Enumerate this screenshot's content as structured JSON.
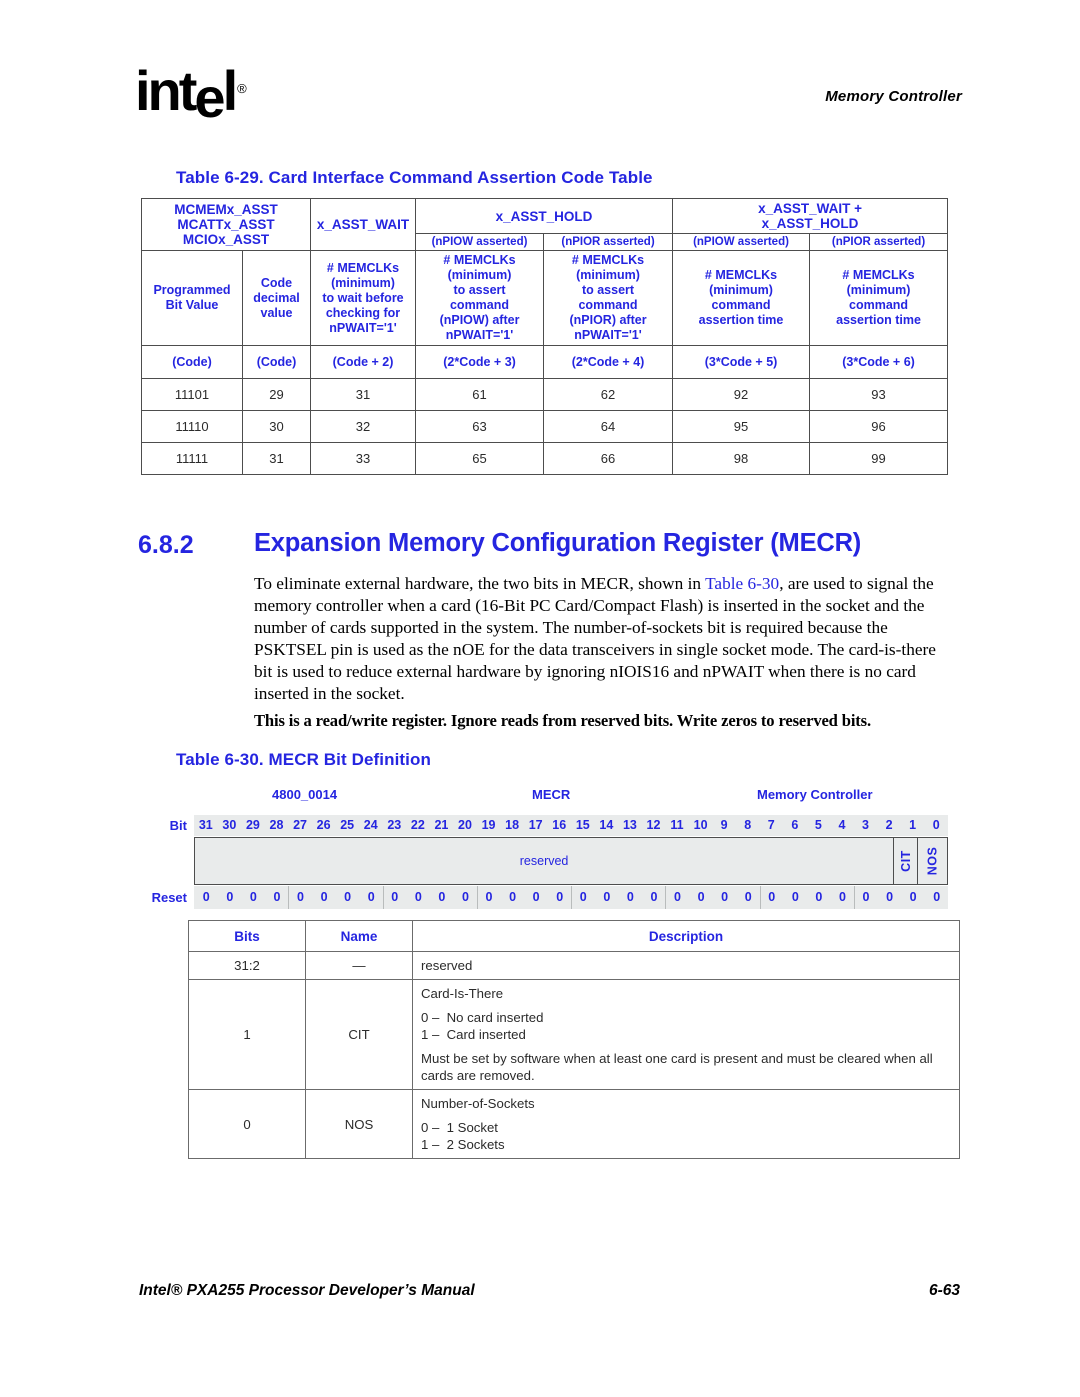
{
  "header": {
    "logo_text": "intel",
    "logo_registered": "®",
    "title": "Memory Controller"
  },
  "table_29": {
    "title": "Table 6-29. Card Interface Command Assertion Code Table",
    "group_headers": {
      "col1": "MCMEMx_ASST\nMCATTx_ASST\nMCIOx_ASST",
      "col1_line1": "MCMEMx_ASST",
      "col1_line2": "MCATTx_ASST",
      "col1_line3": "MCIOx_ASST",
      "asst_wait": "x_ASST_WAIT",
      "asst_hold": "x_ASST_HOLD",
      "wait_plus_hold_line1": "x_ASST_WAIT +",
      "wait_plus_hold_line2": "x_ASST_HOLD"
    },
    "sub_headers": [
      "(nPIOW asserted)",
      "(nPIOR asserted)",
      "(nPIOW asserted)",
      "(nPIOR asserted)"
    ],
    "column_descriptions": {
      "programmed_bit_value_line1": "Programmed",
      "programmed_bit_value_line2": "Bit Value",
      "code_decimal_line1": "Code",
      "code_decimal_line2": "decimal",
      "code_decimal_line3": "value",
      "memclks_wait": "# MEMCLKs\n(minimum)\nto wait before\nchecking for\nnPWAIT='1'",
      "memclks_wait_lines": [
        "# MEMCLKs",
        "(minimum)",
        "to wait before",
        "checking for",
        "nPWAIT='1'"
      ],
      "memclks_piow_assert_lines": [
        "# MEMCLKs",
        "(minimum)",
        "to assert",
        "command",
        "(nPIOW) after",
        "nPWAIT='1'"
      ],
      "memclks_pior_assert_lines": [
        "# MEMCLKs",
        "(minimum)",
        "to assert",
        "command",
        "(nPIOR) after",
        "nPWAIT='1'"
      ],
      "memclks_piow_time_lines": [
        "# MEMCLKs",
        "(minimum)",
        "command",
        "assertion time"
      ],
      "memclks_pior_time_lines": [
        "# MEMCLKs",
        "(minimum)",
        "command",
        "assertion time"
      ]
    },
    "formula_row": [
      "(Code)",
      "(Code)",
      "(Code + 2)",
      "(2*Code + 3)",
      "(2*Code + 4)",
      "(3*Code + 5)",
      "(3*Code + 6)"
    ],
    "rows": [
      [
        "11101",
        "29",
        "31",
        "61",
        "62",
        "92",
        "93"
      ],
      [
        "11110",
        "30",
        "32",
        "63",
        "64",
        "95",
        "96"
      ],
      [
        "11111",
        "31",
        "33",
        "65",
        "66",
        "98",
        "99"
      ]
    ]
  },
  "section": {
    "number": "6.8.2",
    "title": "Expansion Memory Configuration Register (MECR)",
    "paragraph_part1": "To eliminate external hardware, the two bits in MECR, shown in ",
    "paragraph_xref": "Table 6-30",
    "paragraph_part2": ", are used to signal the memory controller when a card (16-Bit PC Card/Compact Flash) is inserted in the socket and the number of cards supported in the system. The number-of-sockets bit is required because the PSKTSEL pin is used as the nOE for the data transceivers in single socket mode. The card-is-there bit is used to reduce external hardware by ignoring nIOIS16 and nPWAIT when there is no card inserted in the socket.",
    "bold_note": "This is a read/write register. Ignore reads from reserved bits. Write zeros to reserved bits."
  },
  "table_30": {
    "title": "Table 6-30. MECR Bit Definition",
    "register_address": "4800_0014",
    "register_name": "MECR",
    "register_unit": "Memory Controller",
    "bit_row_label": "Bit",
    "reset_row_label": "Reset",
    "bit_numbers": [
      "31",
      "30",
      "29",
      "28",
      "27",
      "26",
      "25",
      "24",
      "23",
      "22",
      "21",
      "20",
      "19",
      "18",
      "17",
      "16",
      "15",
      "14",
      "13",
      "12",
      "11",
      "10",
      "9",
      "8",
      "7",
      "6",
      "5",
      "4",
      "3",
      "2",
      "1",
      "0"
    ],
    "reset_values": [
      "0",
      "0",
      "0",
      "0",
      "0",
      "0",
      "0",
      "0",
      "0",
      "0",
      "0",
      "0",
      "0",
      "0",
      "0",
      "0",
      "0",
      "0",
      "0",
      "0",
      "0",
      "0",
      "0",
      "0",
      "0",
      "0",
      "0",
      "0",
      "0",
      "0",
      "0",
      "0"
    ],
    "fields": {
      "reserved": "reserved",
      "bit1": "CIT",
      "bit0": "NOS"
    },
    "desc_headers": [
      "Bits",
      "Name",
      "Description"
    ],
    "desc_rows": [
      {
        "bits": "31:2",
        "name": "—",
        "desc_title": "reserved",
        "enum": [],
        "note": ""
      },
      {
        "bits": "1",
        "name": "CIT",
        "desc_title": "Card-Is-There",
        "enum": [
          "0 –  No card inserted",
          "1 –  Card inserted"
        ],
        "note": "Must be set by software when at least one card is present and must be cleared when all cards are removed."
      },
      {
        "bits": "0",
        "name": "NOS",
        "desc_title": "Number-of-Sockets",
        "enum": [
          "0 –  1 Socket",
          "1 –  2 Sockets"
        ],
        "note": ""
      }
    ]
  },
  "footer": {
    "left": "Intel® PXA255 Processor Developer’s Manual",
    "right": "6-63"
  },
  "colors": {
    "accent_blue": "#2525e0",
    "table_border": "#4d4d4d",
    "field_fill": "#e9ebeb"
  }
}
